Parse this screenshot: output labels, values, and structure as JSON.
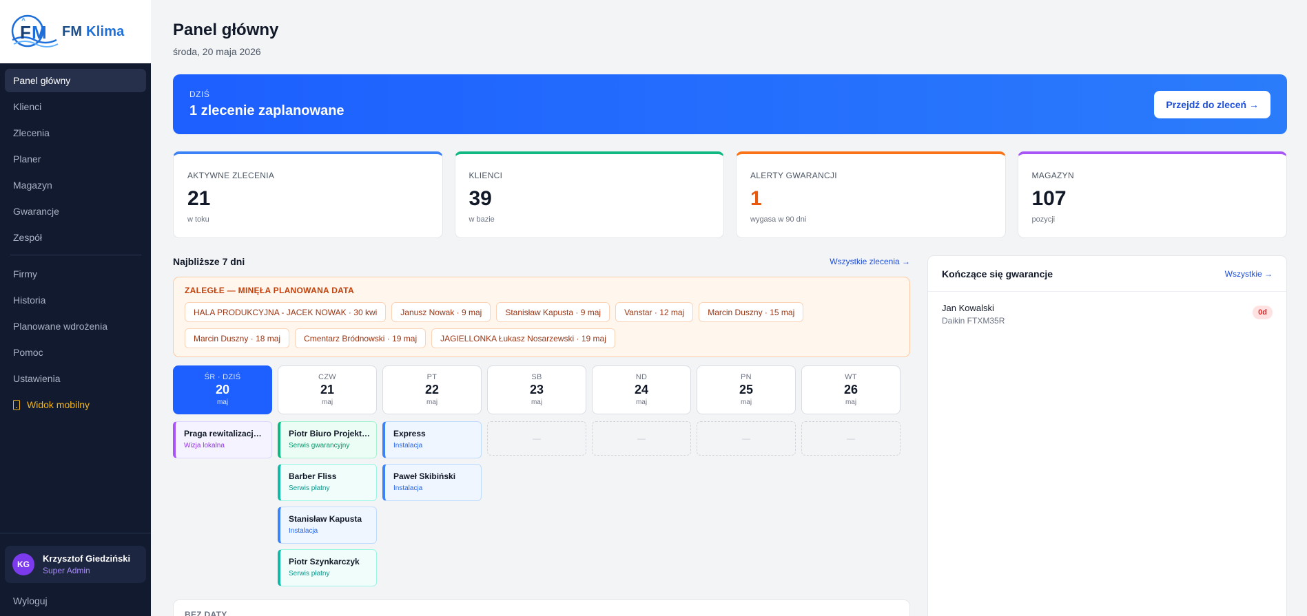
{
  "brand": {
    "name_fm": "FM",
    "name_klima": "Klima"
  },
  "sidebar": {
    "items": [
      {
        "label": "Panel główny"
      },
      {
        "label": "Klienci"
      },
      {
        "label": "Zlecenia"
      },
      {
        "label": "Planer"
      },
      {
        "label": "Magazyn"
      },
      {
        "label": "Gwarancje"
      },
      {
        "label": "Zespół"
      }
    ],
    "items2": [
      {
        "label": "Firmy"
      },
      {
        "label": "Historia"
      },
      {
        "label": "Planowane wdrożenia"
      },
      {
        "label": "Pomoc"
      },
      {
        "label": "Ustawienia"
      },
      {
        "label": "Widok mobilny"
      }
    ],
    "user": {
      "initials": "KG",
      "name": "Krzysztof Giedziński",
      "role": "Super Admin"
    },
    "logout": "Wyloguj"
  },
  "header": {
    "title": "Panel główny",
    "date": "środa, 20 maja 2026"
  },
  "hero": {
    "label": "DZIŚ",
    "title": "1 zlecenie zaplanowane",
    "button": "Przejdź do zleceń →"
  },
  "stats": [
    {
      "label": "AKTYWNE ZLECENIA",
      "value": "21",
      "sub": "w toku",
      "color": "#3b82f6"
    },
    {
      "label": "KLIENCI",
      "value": "39",
      "sub": "w bazie",
      "color": "#10b981"
    },
    {
      "label": "ALERTY GWARANCJI",
      "value": "1",
      "sub": "wygasa w 90 dni",
      "color": "#f97316"
    },
    {
      "label": "MAGAZYN",
      "value": "107",
      "sub": "pozycji",
      "color": "#a855f7"
    }
  ],
  "week": {
    "title": "Najbliższe 7 dni",
    "link": "Wszystkie zlecenia →",
    "overdue_title": "ZALEGŁE — MINĘŁA PLANOWANA DATA",
    "overdue": [
      "HALA PRODUKCYJNA - JACEK NOWAK · 30 kwi",
      "Janusz Nowak · 9 maj",
      "Stanisław Kapusta · 9 maj",
      "Vanstar · 12 maj",
      "Marcin Duszny · 15 maj",
      "Marcin Duszny · 18 maj",
      "Cmentarz Bródnowski · 19 maj",
      "JAGIELLONKA Łukasz Nosarzewski · 19 maj"
    ],
    "days": [
      {
        "abbr": "ŚR · DZIŚ",
        "num": "20",
        "month": "maj",
        "today": true,
        "events": [
          {
            "title": "Praga rewitalizacja kamienicy",
            "type": "Wizja lokalna",
            "kind": "purple"
          }
        ]
      },
      {
        "abbr": "CZW",
        "num": "21",
        "month": "maj",
        "events": [
          {
            "title": "Piotr Biuro Projektowe",
            "type": "Serwis gwarancyjny",
            "kind": "green"
          },
          {
            "title": "Barber Fliss",
            "type": "Serwis płatny",
            "kind": "teal"
          },
          {
            "title": "Stanisław Kapusta",
            "type": "Instalacja",
            "kind": "blue"
          },
          {
            "title": "Piotr Szynkarczyk",
            "type": "Serwis płatny",
            "kind": "teal"
          }
        ]
      },
      {
        "abbr": "PT",
        "num": "22",
        "month": "maj",
        "events": [
          {
            "title": "Express",
            "type": "Instalacja",
            "kind": "blue"
          },
          {
            "title": "Paweł Skibiński",
            "type": "Instalacja",
            "kind": "blue"
          }
        ]
      },
      {
        "abbr": "SB",
        "num": "23",
        "month": "maj",
        "events": []
      },
      {
        "abbr": "ND",
        "num": "24",
        "month": "maj",
        "events": []
      },
      {
        "abbr": "PN",
        "num": "25",
        "month": "maj",
        "events": []
      },
      {
        "abbr": "WT",
        "num": "26",
        "month": "maj",
        "events": []
      }
    ],
    "empty_marker": "—",
    "nodate_title": "BEZ DATY"
  },
  "warranty": {
    "title": "Kończące się gwarancje",
    "link": "Wszystkie →",
    "items": [
      {
        "name": "Jan Kowalski",
        "model": "Daikin FTXM35R",
        "badge": "0d"
      }
    ]
  }
}
